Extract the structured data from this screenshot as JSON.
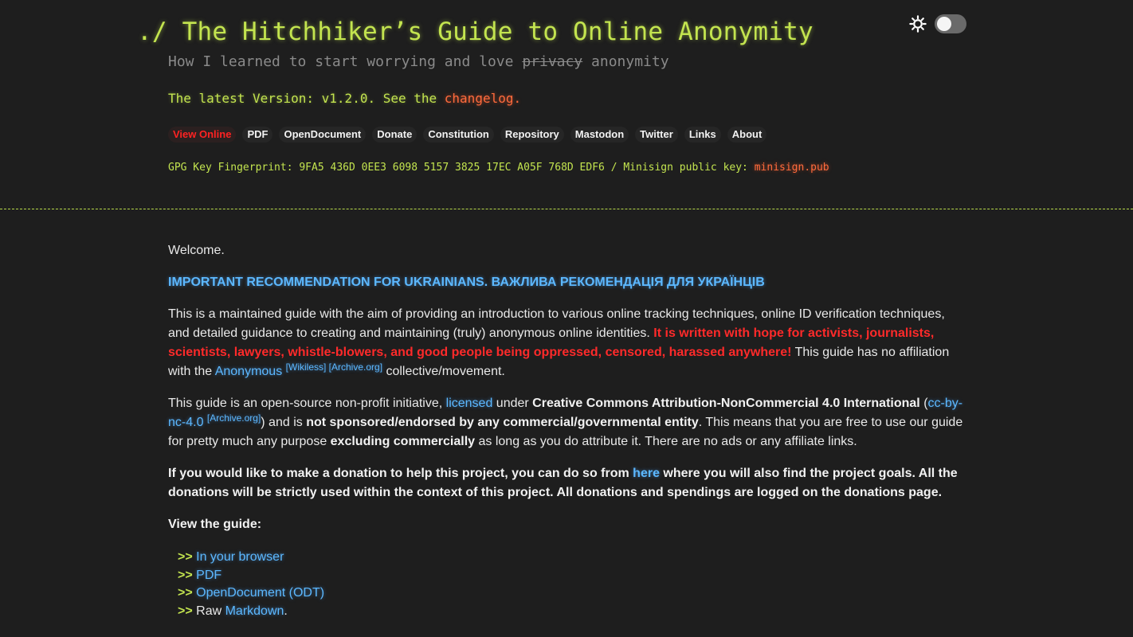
{
  "header": {
    "title": "./ The Hitchhiker’s Guide to Online Anonymity",
    "subtitle_pre": "How I learned to start worrying and love ",
    "subtitle_strike": "privacy",
    "subtitle_post": " anonymity",
    "latest_pre": "The latest Version: v1.2.0. See the ",
    "latest_link": "changelog.",
    "gpg_text": "GPG Key Fingerprint: 9FA5 436D 0EE3 6098 5157 3825 17EC A05F 768D EDF6 / Minisign public key: ",
    "gpg_link": "minisign.pub"
  },
  "nav": {
    "items": [
      "View Online",
      "PDF",
      "OpenDocument",
      "Donate",
      "Constitution",
      "Repository",
      "Mastodon",
      "Twitter",
      "Links",
      "About"
    ]
  },
  "theme": {
    "icon": "sun-icon",
    "dark_mode": true
  },
  "content": {
    "welcome": "Welcome.",
    "ukraine": "IMPORTANT RECOMMENDATION FOR UKRAINIANS. ВАЖЛИВА РЕКОМЕНДАЦІЯ ДЛЯ УКРАЇНЦІВ",
    "p1_a": "This is a maintained guide with the aim of providing an introduction to various online tracking techniques, online ID verification techniques, and detailed guidance to creating and maintaining (truly) anonymous online identities. ",
    "p1_red": "It is written with hope for activists, journalists, scientists, lawyers, whistle-blowers, and good people being oppressed, censored, harassed anywhere!",
    "p1_b": " This guide has no affiliation with the ",
    "p1_anonymous": "Anonymous",
    "p1_wikiless": "[Wikiless]",
    "p1_archive": "[Archive.org]",
    "p1_c": " collective/movement.",
    "p2_a": "This guide is an open-source non-profit initiative, ",
    "p2_licensed": "licensed",
    "p2_b": " under ",
    "p2_cc": "Creative Commons Attribution-NonCommercial 4.0 International",
    "p2_c": " (",
    "p2_ccby": "cc-by-nc-4.0",
    "p2_archive": "[Archive.org]",
    "p2_d": ") and is ",
    "p2_notsponsored": "not sponsored/endorsed by any commercial/governmental entity",
    "p2_e": ". This means that you are free to use our guide for pretty much any purpose ",
    "p2_excl": "excluding commercially",
    "p2_f": " as long as you do attribute it. There are no ads or any affiliate links.",
    "donate_a": "If you would like to make a donation to help this project, you can do so from ",
    "donate_here": "here",
    "donate_b": " where you will also find the project goals. All the donations will be strictly used within the context of this project. All donations and spendings are logged on the donations page.",
    "view_guide": "View the guide:",
    "guide_arrow": ">>",
    "guide_browser": "In your browser",
    "guide_pdf": "PDF",
    "guide_odt": "OpenDocument (ODT)",
    "guide_raw": "Raw ",
    "guide_markdown": "Markdown",
    "guide_period": "."
  }
}
